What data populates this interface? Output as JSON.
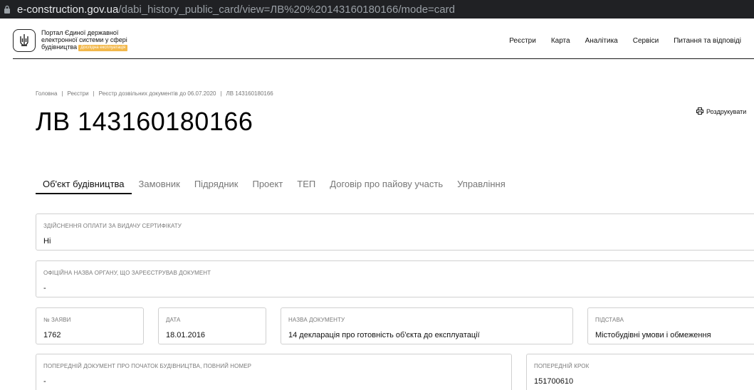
{
  "browser": {
    "url_domain": "e-construction.gov.ua",
    "url_rest": "/dabi_history_public_card/view=ЛВ%20%20143160180166/mode=card"
  },
  "header": {
    "portal_title": "Портал Єдиної державної електронної системи у сфері будівництва",
    "badge": "Дослідна експлуатація",
    "nav": [
      "Реєстри",
      "Карта",
      "Аналітика",
      "Сервіси",
      "Питання та відповіді"
    ]
  },
  "breadcrumb": [
    "Головна",
    "Реєстри",
    "Реєстр дозвільних документів до 06.07.2020",
    "ЛВ 143160180166"
  ],
  "page": {
    "title": "ЛВ 143160180166",
    "print_label": "Роздрукувати"
  },
  "tabs": [
    "Об'єкт будівництва",
    "Замовник",
    "Підрядник",
    "Проект",
    "ТЕП",
    "Договір про пайову участь",
    "Управління"
  ],
  "fields": {
    "payment": {
      "label": "Здійснення оплати за видачу сертифікату",
      "value": "Ні"
    },
    "authority": {
      "label": "Офіційна назва органу, що зареєстрував документ",
      "value": "-"
    },
    "app_no": {
      "label": "№ заяви",
      "value": "1762"
    },
    "date": {
      "label": "Дата",
      "value": "18.01.2016"
    },
    "doc_name": {
      "label": "Назва документу",
      "value": "14 декларація про готовність об'єкта до експлуатації"
    },
    "basis": {
      "label": "Підстава",
      "value": "Містобудівні умови і обмеження"
    },
    "prev_doc": {
      "label": "Попередній документ про початок будівництва, повний номер",
      "value": "-"
    },
    "prev_step": {
      "label": "Попередній крок",
      "value": "151700610"
    }
  }
}
